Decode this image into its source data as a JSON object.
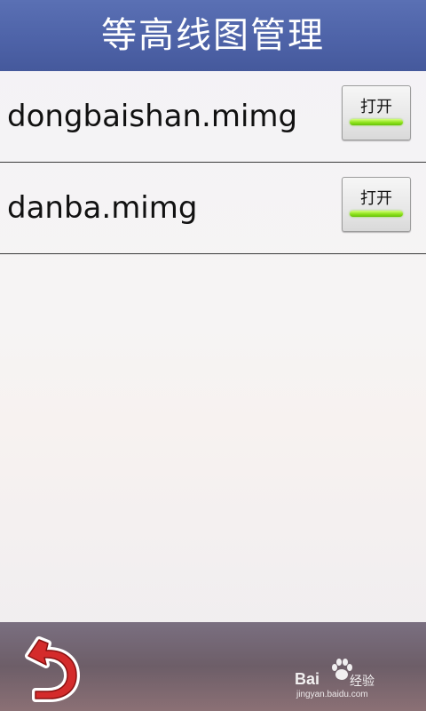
{
  "header": {
    "title": "等高线图管理"
  },
  "files": [
    {
      "name": "dongbaishan.mimg",
      "button_label": "打开"
    },
    {
      "name": "danba.mimg",
      "button_label": "打开"
    }
  ],
  "footer": {
    "back_icon": "back-arrow-icon",
    "watermark": {
      "brand": "Bai",
      "brand_cn": "经验",
      "url": "jingyan.baidu.com"
    }
  },
  "colors": {
    "header_bg": "#4e63a8",
    "indicator_green": "#8ee21a",
    "back_arrow": "#d42b2b"
  }
}
